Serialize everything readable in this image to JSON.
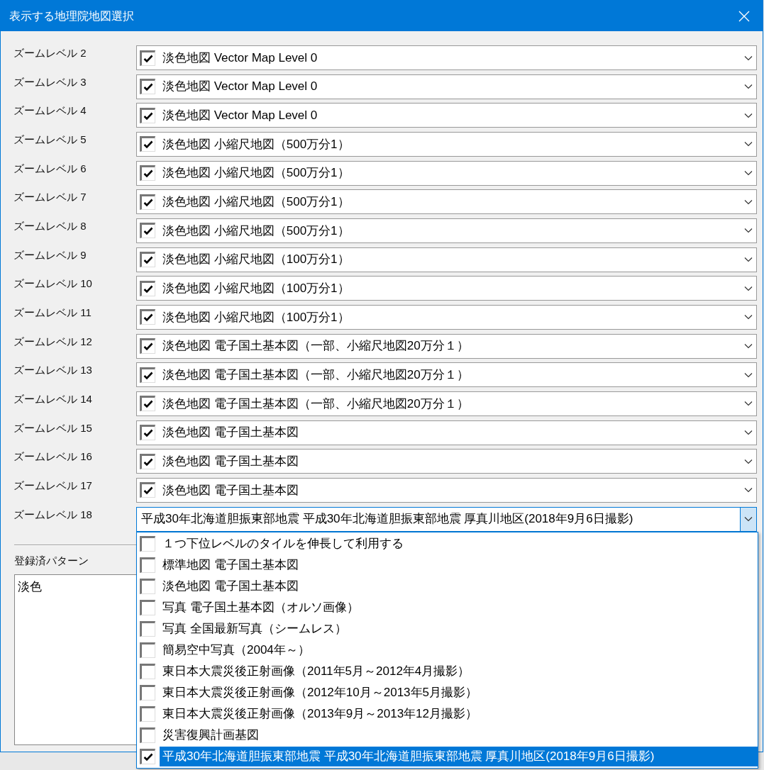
{
  "window": {
    "title": "表示する地理院地図選択"
  },
  "zoom_levels": [
    {
      "label": "ズームレベル 2",
      "checked": true,
      "value": "淡色地図 Vector Map Level 0",
      "expanded": false
    },
    {
      "label": "ズームレベル 3",
      "checked": true,
      "value": "淡色地図 Vector Map Level 0",
      "expanded": false
    },
    {
      "label": "ズームレベル 4",
      "checked": true,
      "value": "淡色地図 Vector Map Level 0",
      "expanded": false
    },
    {
      "label": "ズームレベル 5",
      "checked": true,
      "value": "淡色地図 小縮尺地図（500万分1）",
      "expanded": false
    },
    {
      "label": "ズームレベル 6",
      "checked": true,
      "value": "淡色地図 小縮尺地図（500万分1）",
      "expanded": false
    },
    {
      "label": "ズームレベル 7",
      "checked": true,
      "value": "淡色地図 小縮尺地図（500万分1）",
      "expanded": false
    },
    {
      "label": "ズームレベル 8",
      "checked": true,
      "value": "淡色地図 小縮尺地図（500万分1）",
      "expanded": false
    },
    {
      "label": "ズームレベル 9",
      "checked": true,
      "value": "淡色地図 小縮尺地図（100万分1）",
      "expanded": false
    },
    {
      "label": "ズームレベル 10",
      "checked": true,
      "value": "淡色地図 小縮尺地図（100万分1）",
      "expanded": false
    },
    {
      "label": "ズームレベル 11",
      "checked": true,
      "value": "淡色地図 小縮尺地図（100万分1）",
      "expanded": false
    },
    {
      "label": "ズームレベル 12",
      "checked": true,
      "value": "淡色地図 電子国土基本図（一部、小縮尺地図20万分１）",
      "expanded": false
    },
    {
      "label": "ズームレベル 13",
      "checked": true,
      "value": "淡色地図 電子国土基本図（一部、小縮尺地図20万分１）",
      "expanded": false
    },
    {
      "label": "ズームレベル 14",
      "checked": true,
      "value": "淡色地図 電子国土基本図（一部、小縮尺地図20万分１）",
      "expanded": false
    },
    {
      "label": "ズームレベル 15",
      "checked": true,
      "value": "淡色地図 電子国土基本図",
      "expanded": false
    },
    {
      "label": "ズームレベル 16",
      "checked": true,
      "value": "淡色地図 電子国土基本図",
      "expanded": false
    },
    {
      "label": "ズームレベル 17",
      "checked": true,
      "value": "淡色地図 電子国土基本図",
      "expanded": false
    },
    {
      "label": "ズームレベル 18",
      "value": "平成30年北海道胆振東部地震 平成30年北海道胆振東部地震 厚真川地区(2018年9月6日撮影)",
      "expanded": true
    }
  ],
  "dropdown_options": [
    {
      "label": "１つ下位レベルのタイルを伸長して利用する",
      "checked": false,
      "selected": false
    },
    {
      "label": "標準地図 電子国土基本図",
      "checked": false,
      "selected": false
    },
    {
      "label": "淡色地図 電子国土基本図",
      "checked": false,
      "selected": false
    },
    {
      "label": "写真 電子国土基本図（オルソ画像）",
      "checked": false,
      "selected": false
    },
    {
      "label": "写真 全国最新写真（シームレス）",
      "checked": false,
      "selected": false
    },
    {
      "label": "簡易空中写真（2004年～）",
      "checked": false,
      "selected": false
    },
    {
      "label": "東日本大震災後正射画像（2011年5月～2012年4月撮影）",
      "checked": false,
      "selected": false
    },
    {
      "label": "東日本大震災後正射画像（2012年10月～2013年5月撮影）",
      "checked": false,
      "selected": false
    },
    {
      "label": "東日本大震災後正射画像（2013年9月～2013年12月撮影）",
      "checked": false,
      "selected": false
    },
    {
      "label": "災害復興計画基図",
      "checked": false,
      "selected": false
    },
    {
      "label": "平成30年北海道胆振東部地震 平成30年北海道胆振東部地震 厚真川地区(2018年9月6日撮影)",
      "checked": true,
      "selected": true
    }
  ],
  "patterns": {
    "label": "登録済パターン",
    "items": [
      "淡色"
    ]
  }
}
